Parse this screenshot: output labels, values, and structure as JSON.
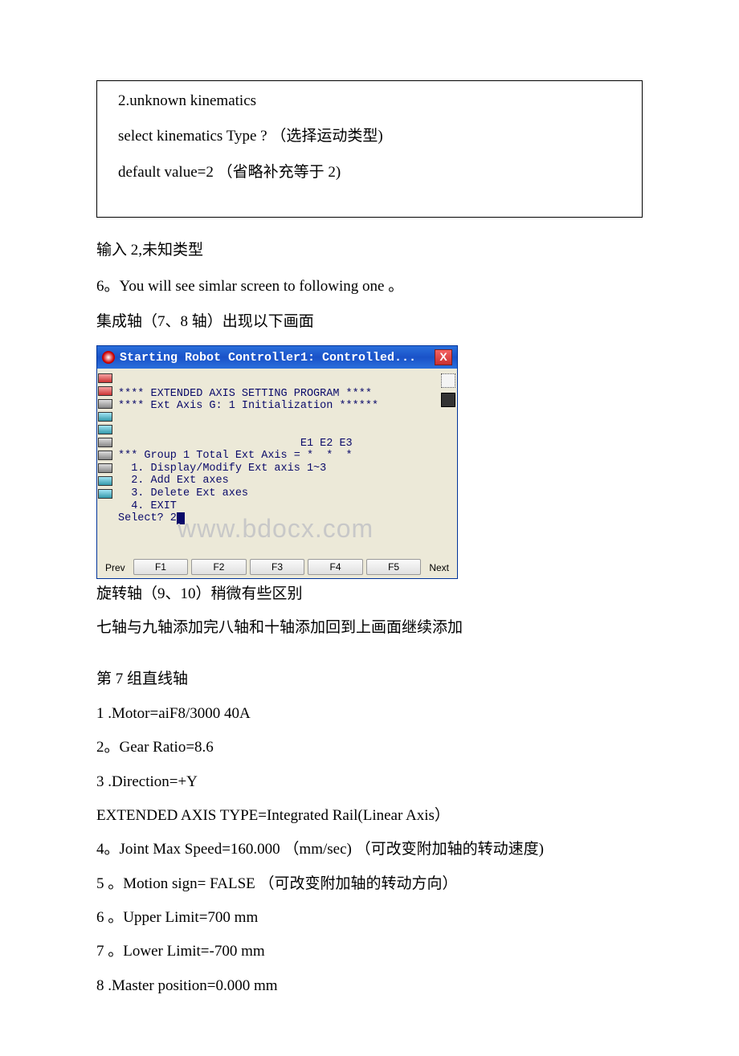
{
  "boxed": {
    "line1": "2.unknown kinematics",
    "line2": "select kinematics Type ? （选择运动类型)",
    "line3": "default value=2 （省略补充等于 2)"
  },
  "body": {
    "p1": "输入 2,未知类型",
    "p2": "6。You will see simlar screen to following one 。",
    "p3": "集成轴（7、8 轴）出现以下画面"
  },
  "xp": {
    "title": "Starting Robot Controller1: Controlled...",
    "close": "X",
    "terminal": "\n**** EXTENDED AXIS SETTING PROGRAM ****\n**** Ext Axis G: 1 Initialization ******\n\n\n                            E1 E2 E3\n*** Group 1 Total Ext Axis = *  *  *\n  1. Display/Modify Ext axis 1~3\n  2. Add Ext axes\n  3. Delete Ext axes\n  4. EXIT\nSelect? 2",
    "watermark": "www.bdocx.com",
    "prev": "Prev",
    "next": "Next",
    "f1": "F1",
    "f2": "F2",
    "f3": "F3",
    "f4": "F4",
    "f5": "F5"
  },
  "after": {
    "p1": "旋转轴（9、10）稍微有些区别",
    "p2": "七轴与九轴添加完八轴和十轴添加回到上画面继续添加",
    "p3": "第 7 组直线轴",
    "p4": "1 .Motor=aiF8/3000 40A",
    "p5": "2。Gear Ratio=8.6",
    "p6": "3 .Direction=+Y",
    "p7": " EXTENDED AXIS TYPE=Integrated Rail(Linear Axis）",
    "p8": "4。Joint Max Speed=160.000 （mm/sec) （可改变附加轴的转动速度)",
    "p9": "5 。Motion sign= FALSE （可改变附加轴的转动方向）",
    "p10": "6 。Upper Limit=700 mm",
    "p11": "7 。Lower Limit=-700 mm",
    "p12": "8 .Master position=0.000 mm"
  }
}
